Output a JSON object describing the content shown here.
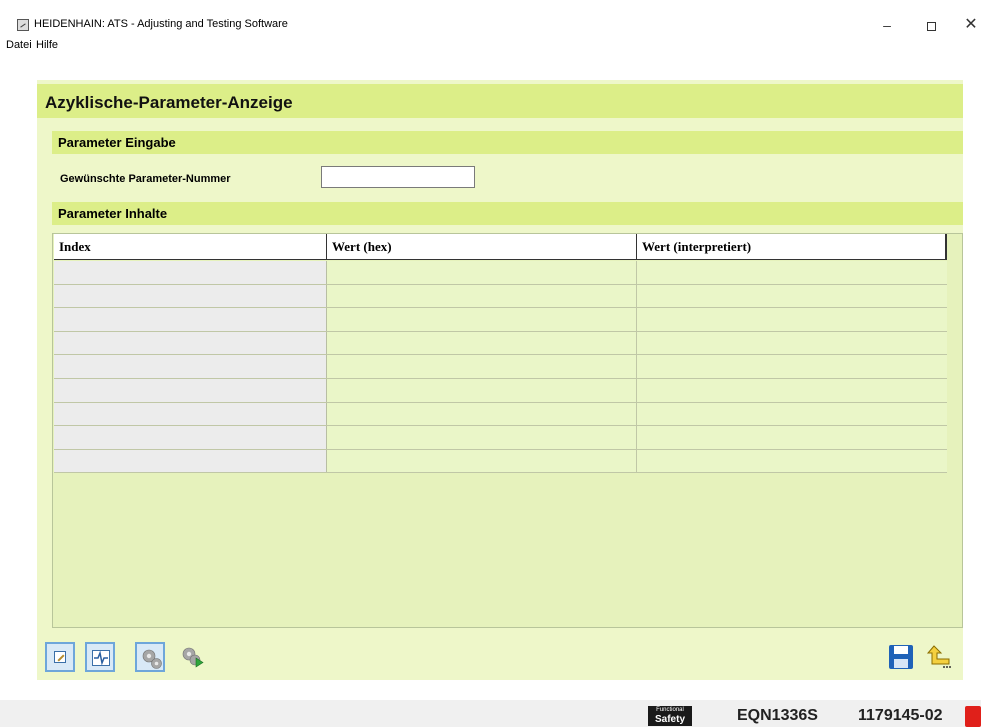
{
  "window": {
    "title": "HEIDENHAIN: ATS - Adjusting and Testing Software",
    "minimize_glyph": "–",
    "close_glyph": "✕"
  },
  "menu": {
    "items": [
      {
        "label": "Datei"
      },
      {
        "label": "Hilfe"
      }
    ]
  },
  "page": {
    "title": "Azyklische-Parameter-Anzeige"
  },
  "eingabe": {
    "section_title": "Parameter Eingabe",
    "field_label": "Gewünschte Parameter-Nummer",
    "field_value": ""
  },
  "inhalte": {
    "section_title": "Parameter Inhalte",
    "columns": [
      "Index",
      "Wert (hex)",
      "Wert (interpretiert)"
    ],
    "rows": [
      [
        "",
        "",
        ""
      ],
      [
        "",
        "",
        ""
      ],
      [
        "",
        "",
        ""
      ],
      [
        "",
        "",
        ""
      ],
      [
        "",
        "",
        ""
      ],
      [
        "",
        "",
        ""
      ],
      [
        "",
        "",
        ""
      ],
      [
        "",
        "",
        ""
      ],
      [
        "",
        "",
        ""
      ]
    ]
  },
  "toolbar": {
    "buttons": [
      {
        "icon": "edit-icon",
        "active": true
      },
      {
        "icon": "signal-icon",
        "active": true
      },
      {
        "icon": "gear-icon",
        "active": true
      },
      {
        "icon": "gear-play-icon",
        "active": false
      },
      {
        "icon": "save-icon",
        "active": false
      },
      {
        "icon": "back-arrow-icon",
        "active": false
      }
    ]
  },
  "status": {
    "badge_line1": "Functional",
    "badge_line2": "Safety",
    "model": "EQN1336S",
    "serial": "1179145-02",
    "indicator_color": "#e0201a"
  }
}
